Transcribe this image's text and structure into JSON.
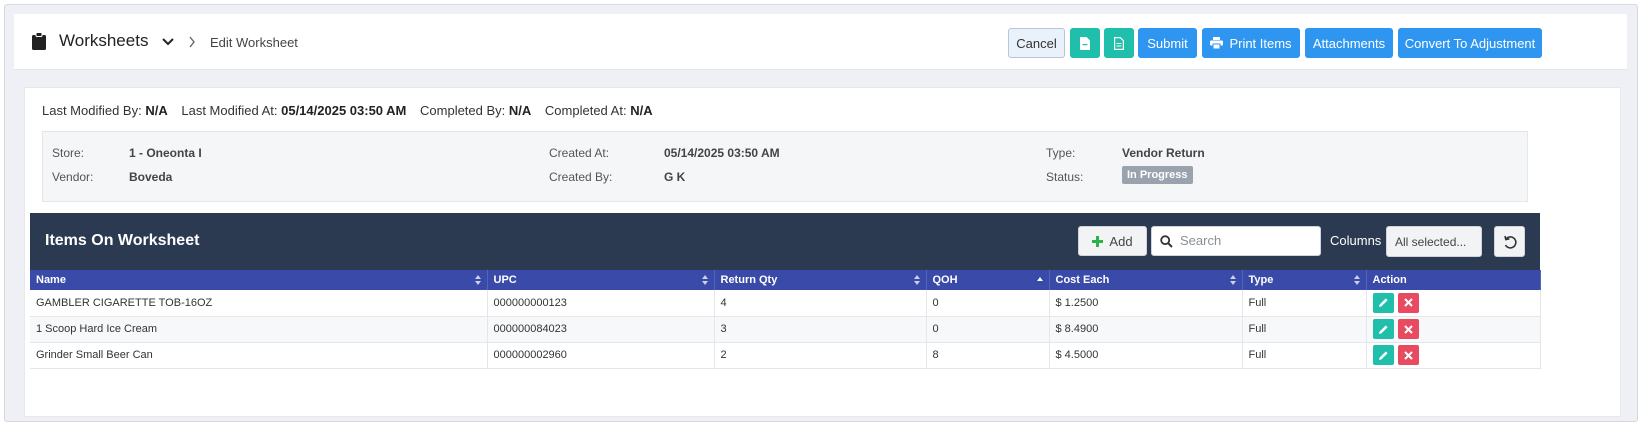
{
  "header": {
    "title": "Worksheets",
    "breadcrumb": "Edit Worksheet",
    "cancel_label": "Cancel",
    "submit_label": "Submit",
    "print_label": "Print Items",
    "attachments_label": "Attachments",
    "convert_label": "Convert To Adjustment"
  },
  "meta": {
    "modified_by_label": "Last Modified By:",
    "modified_by_value": "N/A",
    "modified_at_label": "Last Modified At:",
    "modified_at_value": "05/14/2025 03:50 AM",
    "completed_by_label": "Completed By:",
    "completed_by_value": "N/A",
    "completed_at_label": "Completed At:",
    "completed_at_value": "N/A"
  },
  "details": {
    "store_label": "Store:",
    "store_value": "1 - Oneonta I",
    "vendor_label": "Vendor:",
    "vendor_value": "Boveda",
    "created_at_label": "Created At:",
    "created_at_value": "05/14/2025 03:50 AM",
    "created_by_label": "Created By:",
    "created_by_value": "G K",
    "type_label": "Type:",
    "type_value": "Vendor Return",
    "status_label": "Status:",
    "status_value": "In Progress"
  },
  "items": {
    "title": "Items On Worksheet",
    "add_label": "Add",
    "search_placeholder": "Search",
    "columns_label": "Columns",
    "columns_value": "All selected...",
    "headers": {
      "name": "Name",
      "upc": "UPC",
      "return_qty": "Return Qty",
      "qoh": "QOH",
      "cost_each": "Cost Each",
      "type": "Type",
      "action": "Action"
    },
    "rows": [
      {
        "name": "GAMBLER CIGARETTE TOB-16OZ",
        "upc": "000000000123",
        "return_qty": "4",
        "qoh": "0",
        "cost_each": "$ 1.2500",
        "type": "Full"
      },
      {
        "name": "1 Scoop Hard Ice Cream",
        "upc": "000000084023",
        "return_qty": "3",
        "qoh": "0",
        "cost_each": "$ 8.4900",
        "type": "Full"
      },
      {
        "name": "Grinder Small Beer Can",
        "upc": "000000002960",
        "return_qty": "2",
        "qoh": "8",
        "cost_each": "$ 4.5000",
        "type": "Full"
      }
    ]
  },
  "colors": {
    "teal": "#1fbfab",
    "blue": "#2e96f0",
    "navy": "#2b3a50",
    "header_row": "#3a4aa8",
    "delete": "#e84a5f"
  }
}
